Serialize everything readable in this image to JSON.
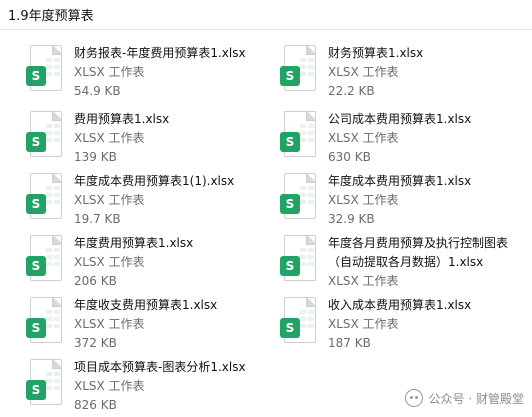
{
  "folder": {
    "title": "1.9年度预算表"
  },
  "files": [
    {
      "name": "财务报表-年度费用预算表1.xlsx",
      "type": "XLSX 工作表",
      "size": "54.9 KB",
      "icon": "xlsx-file-icon"
    },
    {
      "name": "财务预算表1.xlsx",
      "type": "XLSX 工作表",
      "size": "22.2 KB",
      "icon": "xlsx-file-icon"
    },
    {
      "name": "费用预算表1.xlsx",
      "type": "XLSX 工作表",
      "size": "139 KB",
      "icon": "xlsx-file-icon"
    },
    {
      "name": "公司成本费用预算表1.xlsx",
      "type": "XLSX 工作表",
      "size": "630 KB",
      "icon": "xlsx-file-icon"
    },
    {
      "name": "年度成本费用预算表1(1).xlsx",
      "type": "XLSX 工作表",
      "size": "19.7 KB",
      "icon": "xlsx-file-icon"
    },
    {
      "name": "年度成本费用预算表1.xlsx",
      "type": "XLSX 工作表",
      "size": "32.9 KB",
      "icon": "xlsx-file-icon"
    },
    {
      "name": "年度费用预算表1.xlsx",
      "type": "XLSX 工作表",
      "size": "206 KB",
      "icon": "xlsx-file-icon"
    },
    {
      "name": "年度各月费用预算及执行控制图表",
      "name_line2": "（自动提取各月数据）1.xlsx",
      "type": "XLSX 工作表",
      "size": "",
      "icon": "xlsx-file-icon"
    },
    {
      "name": "年度收支费用预算表1.xlsx",
      "type": "XLSX 工作表",
      "size": "372 KB",
      "icon": "xlsx-file-icon"
    },
    {
      "name": "收入成本费用预算表1.xlsx",
      "type": "XLSX 工作表",
      "size": "187 KB",
      "icon": "xlsx-file-icon"
    },
    {
      "name": "项目成本预算表-图表分析1.xlsx",
      "type": "XLSX 工作表",
      "size": "826 KB",
      "icon": "xlsx-file-icon"
    }
  ],
  "watermark": {
    "text": "公众号 · 财管殿堂",
    "icon": "wechat-icon"
  },
  "colors": {
    "excel_green": "#21a366",
    "meta_text": "#6b6b6b"
  }
}
